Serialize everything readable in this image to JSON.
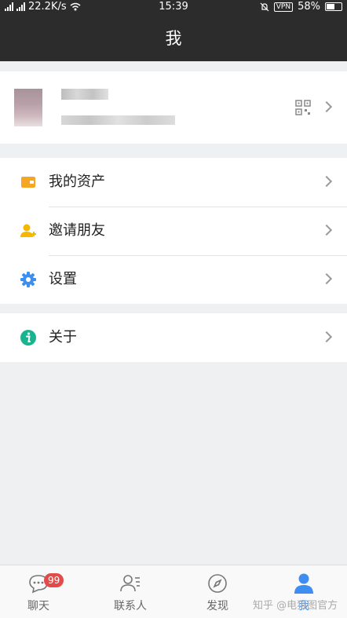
{
  "status_bar": {
    "network_speed": "22.2K/s",
    "time": "15:39",
    "vpn": "VPN",
    "battery": "58%",
    "battery_level": 0.58
  },
  "header": {
    "title": "我"
  },
  "menu": {
    "group1": [
      {
        "label": "我的资产",
        "icon": "wallet-icon",
        "color": "#f5a623"
      },
      {
        "label": "邀请朋友",
        "icon": "add-user-icon",
        "color": "#f5b800"
      },
      {
        "label": "设置",
        "icon": "gear-icon",
        "color": "#3d8ef0"
      }
    ],
    "group2": [
      {
        "label": "关于",
        "icon": "info-icon",
        "color": "#19b38f"
      }
    ]
  },
  "tabs": [
    {
      "label": "聊天",
      "badge": "99",
      "icon": "chat-icon"
    },
    {
      "label": "联系人",
      "icon": "contacts-icon"
    },
    {
      "label": "发现",
      "icon": "compass-icon"
    },
    {
      "label": "我",
      "icon": "person-icon",
      "active": true,
      "active_color": "#3d8ef0"
    }
  ],
  "watermark": "知乎 @电狼图官方"
}
